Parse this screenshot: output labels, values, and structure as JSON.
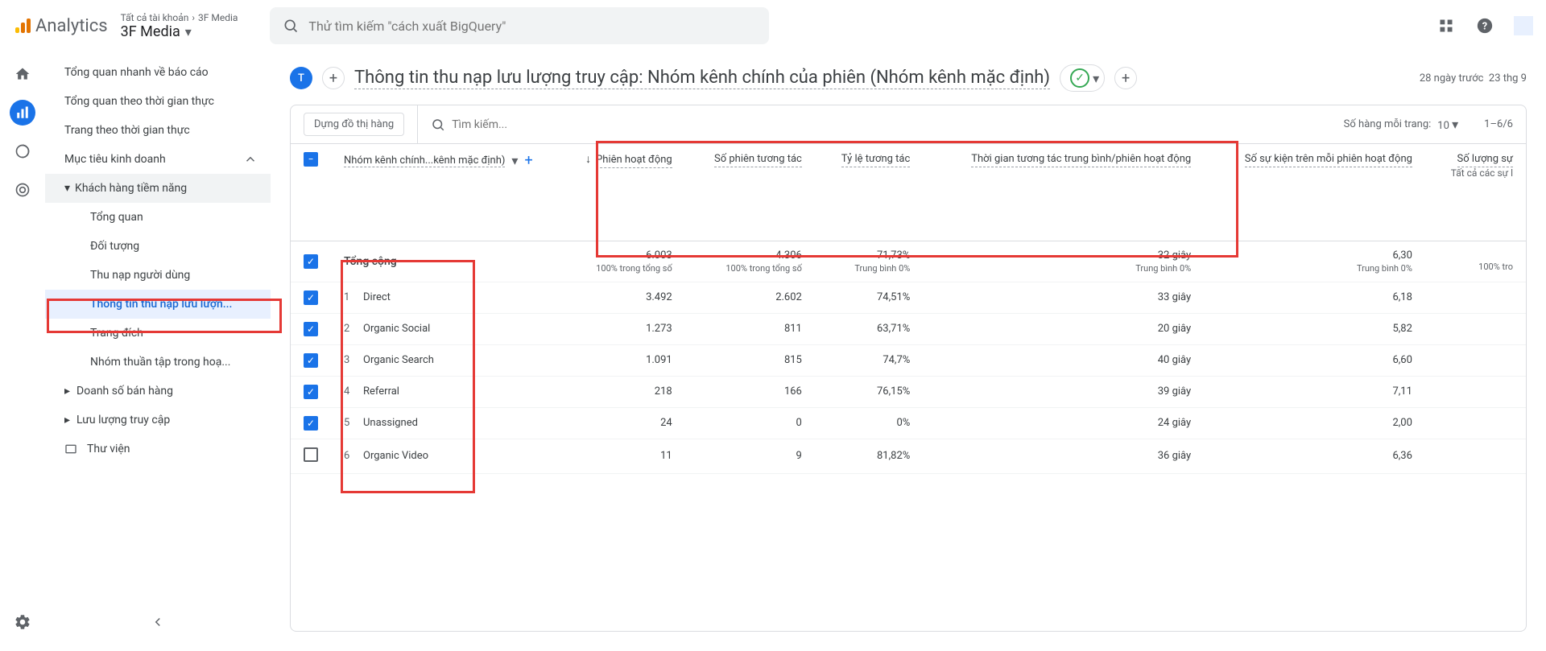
{
  "header": {
    "logo_text": "Analytics",
    "breadcrumb_all": "Tất cả tài khoản",
    "breadcrumb_prop": "3F Media",
    "property_name": "3F Media",
    "search_placeholder": "Thử tìm kiếm \"cách xuất BigQuery\""
  },
  "sidebar": {
    "i0": "Tổng quan nhanh về báo cáo",
    "i1": "Tổng quan theo thời gian thực",
    "i2": "Trang theo thời gian thực",
    "sec0": "Mục tiêu kinh doanh",
    "sub0": "Khách hàng tiềm năng",
    "s0": "Tổng quan",
    "s1": "Đối tượng",
    "s2": "Thu nạp người dùng",
    "s3": "Thông tin thu nạp lưu lượn...",
    "s4": "Trang đích",
    "s5": "Nhóm thuần tập trong hoạ...",
    "sub1": "Doanh số bán hàng",
    "sub2": "Lưu lượng truy cập",
    "lib": "Thư viện"
  },
  "page": {
    "avatar": "T",
    "title": "Thông tin thu nạp lưu lượng truy cập: Nhóm kênh chính của phiên (Nhóm kênh mặc định)",
    "date_label": "28 ngày trước",
    "date_range": "23 thg 9"
  },
  "table": {
    "build_btn": "Dựng đồ thị hàng",
    "search_placeholder": "Tìm kiếm...",
    "rows_label": "Số hàng mỗi trang:",
    "rows_per_page": "10",
    "page_info": "1–6/6",
    "dimension": "Nhóm kênh chính...kênh mặc định)",
    "cols": {
      "c1": "Phiên hoạt động",
      "c2": "Số phiên tương tác",
      "c3": "Tỷ lệ tương tác",
      "c4": "Thời gian tương tác trung bình/phiên hoạt động",
      "c5": "Số sự kiện trên mỗi phiên hoạt động",
      "c6": "Số lượng sự",
      "c6_sub": "Tất cả các sự l"
    },
    "totals": {
      "label": "Tổng cộng",
      "c1": "6.003",
      "c1_sub": "100% trong tổng số",
      "c2": "4.306",
      "c2_sub": "100% trong tổng số",
      "c3": "71,73%",
      "c3_sub": "Trung bình 0%",
      "c4": "32 giây",
      "c4_sub": "Trung bình 0%",
      "c5": "6,30",
      "c5_sub": "Trung bình 0%",
      "c6": "100% tro"
    },
    "rows": [
      {
        "idx": "1",
        "name": "Direct",
        "c1": "3.492",
        "c2": "2.602",
        "c3": "74,51%",
        "c4": "33 giây",
        "c5": "6,18",
        "checked": true
      },
      {
        "idx": "2",
        "name": "Organic Social",
        "c1": "1.273",
        "c2": "811",
        "c3": "63,71%",
        "c4": "20 giây",
        "c5": "5,82",
        "checked": true
      },
      {
        "idx": "3",
        "name": "Organic Search",
        "c1": "1.091",
        "c2": "815",
        "c3": "74,7%",
        "c4": "40 giây",
        "c5": "6,60",
        "checked": true
      },
      {
        "idx": "4",
        "name": "Referral",
        "c1": "218",
        "c2": "166",
        "c3": "76,15%",
        "c4": "39 giây",
        "c5": "7,11",
        "checked": true
      },
      {
        "idx": "5",
        "name": "Unassigned",
        "c1": "24",
        "c2": "0",
        "c3": "0%",
        "c4": "24 giây",
        "c5": "2,00",
        "checked": true
      },
      {
        "idx": "6",
        "name": "Organic Video",
        "c1": "11",
        "c2": "9",
        "c3": "81,82%",
        "c4": "36 giây",
        "c5": "6,36",
        "checked": false
      }
    ]
  }
}
